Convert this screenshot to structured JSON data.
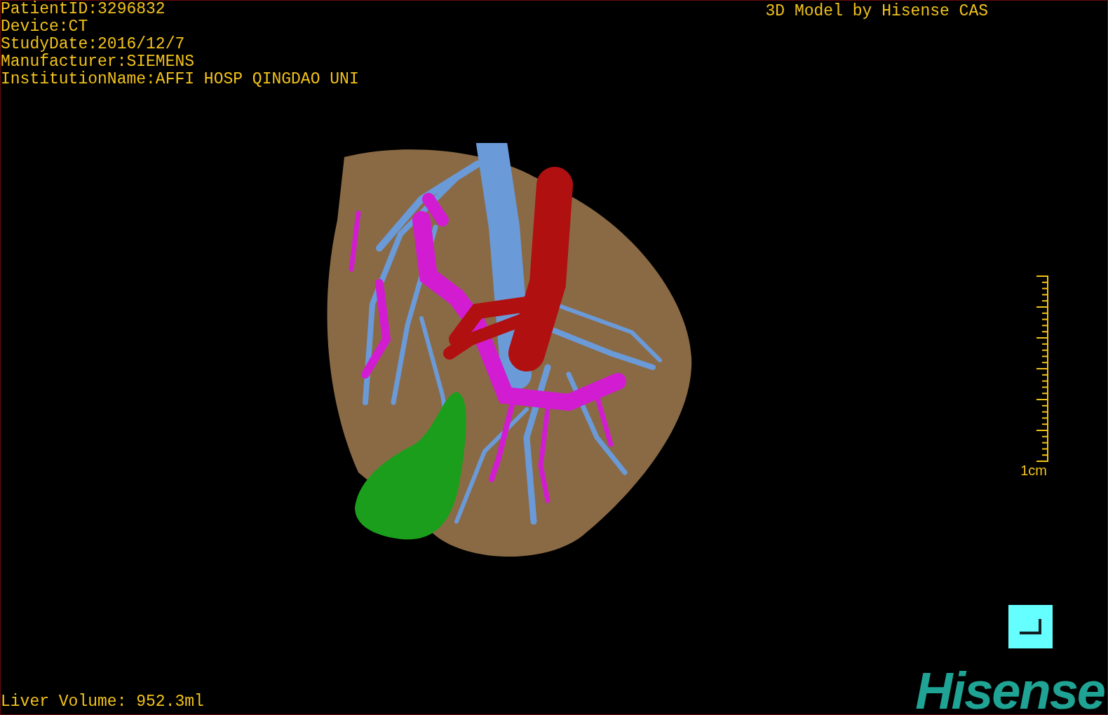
{
  "patient_info": [
    "PatientID:3296832",
    "Device:CT",
    "StudyDate:2016/12/7",
    "Manufacturer:SIEMENS",
    "InstitutionName:AFFI HOSP QINGDAO UNI"
  ],
  "title": "3D Model by Hisense CAS",
  "scale_bar": {
    "label": "1cm"
  },
  "liver_volume": "Liver Volume: 952.3ml",
  "logo": "Hisense"
}
